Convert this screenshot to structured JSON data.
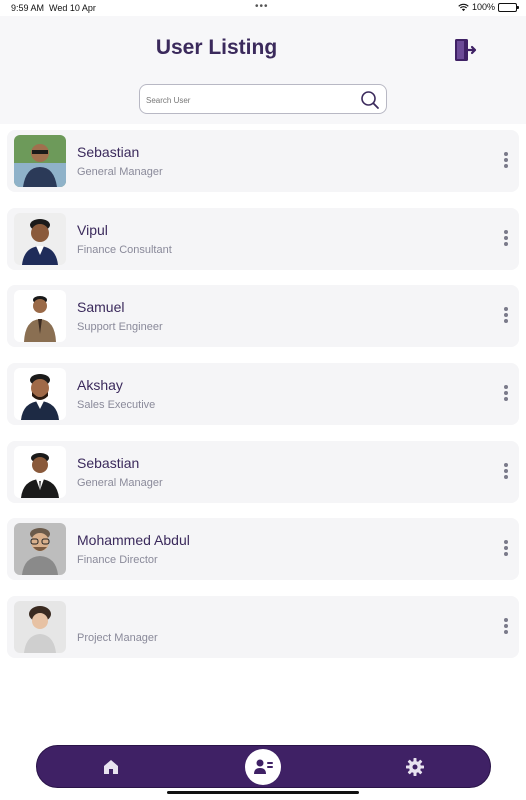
{
  "status_bar": {
    "time": "9:59 AM",
    "date": "Wed 10 Apr",
    "battery": "100%"
  },
  "header": {
    "title": "User Listing"
  },
  "search": {
    "placeholder": "Search User"
  },
  "users": [
    {
      "name": "Sebastian",
      "role": "General Manager"
    },
    {
      "name": "Vipul",
      "role": "Finance Consultant"
    },
    {
      "name": "Samuel",
      "role": "Support Engineer"
    },
    {
      "name": "Akshay",
      "role": "Sales Executive"
    },
    {
      "name": "Sebastian",
      "role": "General Manager"
    },
    {
      "name": "Mohammed Abdul",
      "role": "Finance Director"
    },
    {
      "name": "",
      "role": "Project Manager"
    }
  ],
  "icons": {
    "logout": "logout-icon",
    "search": "search-icon",
    "more": "more-vertical-icon",
    "home": "home-icon",
    "users": "user-list-icon",
    "settings": "gear-icon"
  },
  "colors": {
    "primary": "#3f2165",
    "text": "#3b2a5c",
    "muted": "#8a8a9a",
    "card": "#f5f5f7"
  }
}
